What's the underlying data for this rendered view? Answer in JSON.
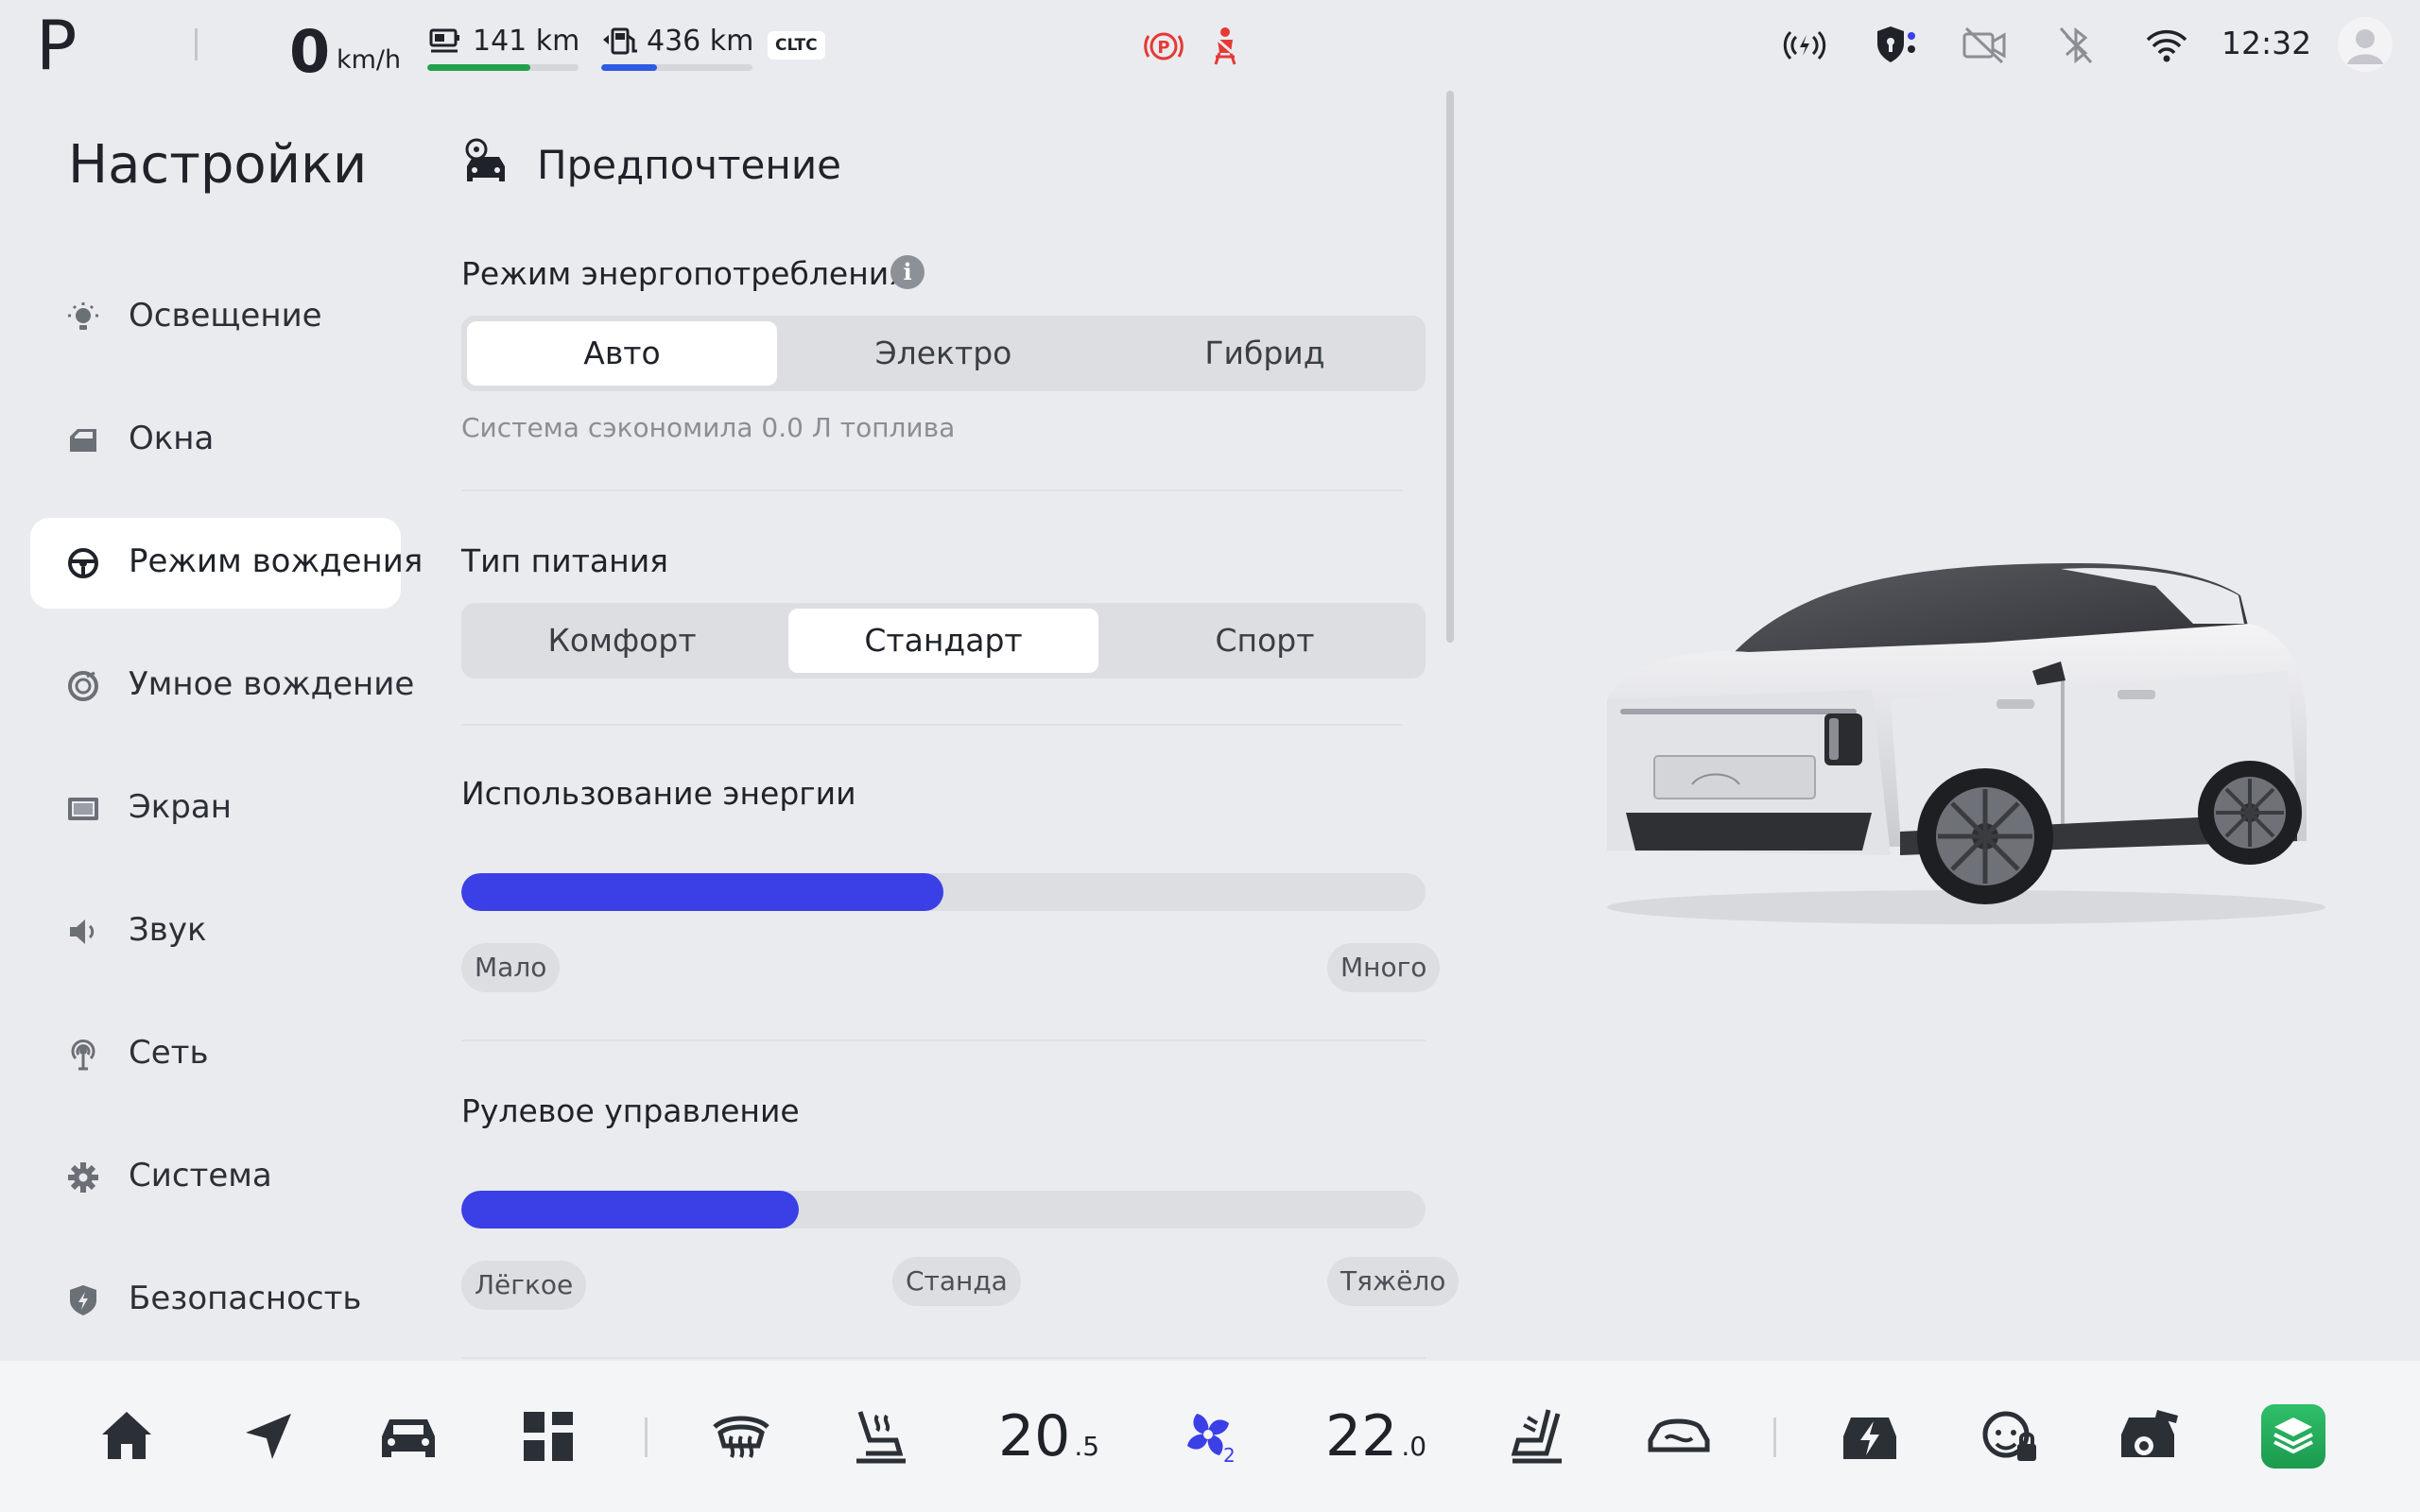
{
  "status_bar": {
    "gear": "P",
    "speed": "0",
    "speed_unit": "km/h",
    "electric_range": "141 km",
    "electric_range_fraction": 0.68,
    "fuel_range": "436 km",
    "fuel_range_fraction": 0.37,
    "range_standard": "CLTC",
    "time": "12:32",
    "colors": {
      "electric": "#22a04a",
      "fuel": "#2d5be3",
      "warning": "#e53935"
    },
    "icons": [
      "parking-brake-warning-icon",
      "seatbelt-warning-icon",
      "v2x-signal-icon",
      "security-shield-icon",
      "camera-off-icon",
      "bluetooth-off-icon",
      "wifi-icon",
      "user-avatar-icon"
    ]
  },
  "sidebar": {
    "title": "Настройки",
    "items": [
      {
        "label": "Освещение",
        "icon": "light-icon"
      },
      {
        "label": "Окна",
        "icon": "window-icon"
      },
      {
        "label": "Режим вождения",
        "icon": "steering-wheel-icon",
        "active": true
      },
      {
        "label": "Умное вождение",
        "icon": "smart-driving-icon"
      },
      {
        "label": "Экран",
        "icon": "screen-icon"
      },
      {
        "label": "Звук",
        "icon": "speaker-icon"
      },
      {
        "label": "Сеть",
        "icon": "network-icon"
      },
      {
        "label": "Система",
        "icon": "gear-icon"
      },
      {
        "label": "Безопасность",
        "icon": "shield-icon"
      }
    ]
  },
  "main": {
    "section_title": "Предпочтение",
    "energy_mode": {
      "label": "Режим энергопотребления",
      "options": [
        "Авто",
        "Электро",
        "Гибрид"
      ],
      "selected": "Авто",
      "hint": "Система сэкономила 0.0 Л топлива"
    },
    "power_type": {
      "label": "Тип питания",
      "options": [
        "Комфорт",
        "Стандарт",
        "Спорт"
      ],
      "selected": "Стандарт"
    },
    "energy_usage": {
      "label": "Использование энергии",
      "value_fraction": 0.5,
      "min_label": "Мало",
      "max_label": "Много"
    },
    "steering": {
      "label": "Рулевое управление",
      "value_fraction": 0.35,
      "min_label": "Лёгкое",
      "mid_label": "Станда",
      "max_label": "Тяжёло"
    },
    "accent_color": "#3a3fe6"
  },
  "dock": {
    "left_temp": {
      "int": "20",
      "dec": ".5"
    },
    "fan_level": "2",
    "right_temp": {
      "int": "22",
      "dec": ".0"
    },
    "icons": [
      "home-icon",
      "navigation-icon",
      "car-icon",
      "apps-grid-icon",
      "rear-defrost-icon",
      "seat-heat-icon",
      "fan-icon",
      "seat-recline-icon",
      "car-air-icon",
      "charging-icon",
      "driver-monitor-icon",
      "camera-car-icon",
      "app-stack-icon"
    ]
  }
}
